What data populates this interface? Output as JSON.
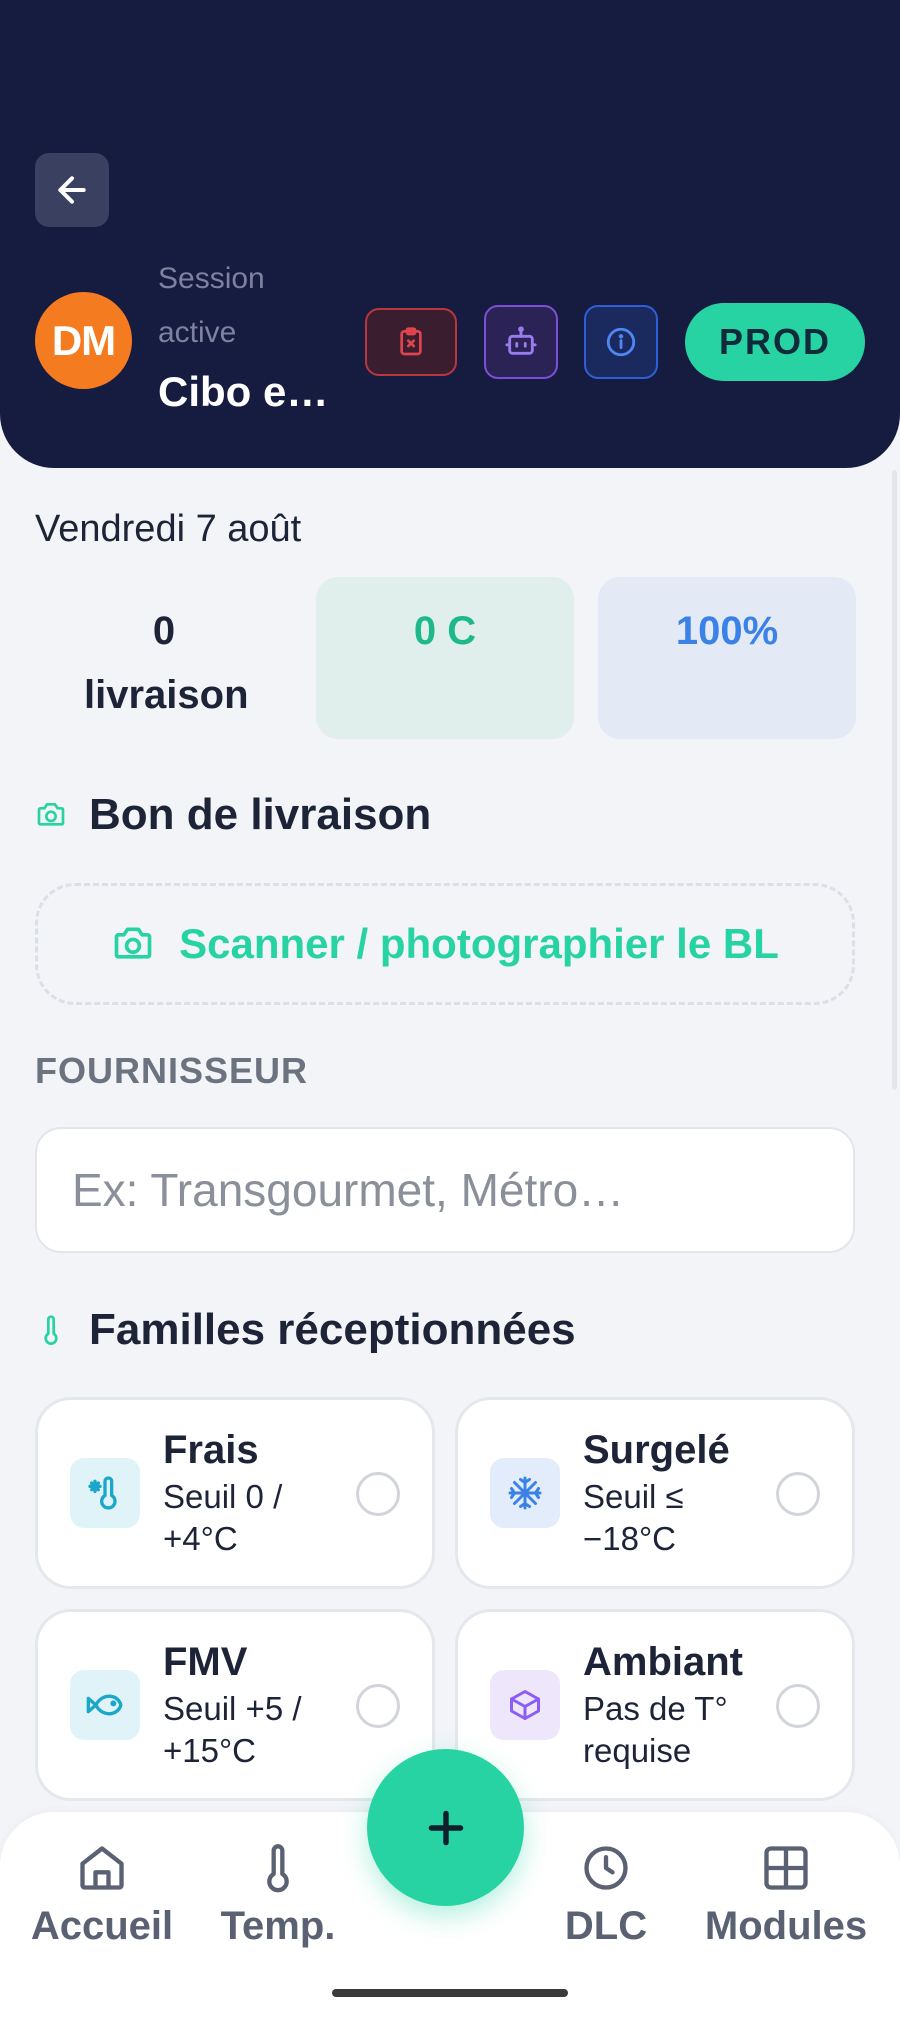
{
  "header": {
    "session_label": "Session active",
    "avatar_initials": "DM",
    "session_name": "Cibo e…",
    "env_badge": "PROD"
  },
  "main": {
    "date": "Vendredi 7 août",
    "stats": [
      {
        "value": "0 livraison"
      },
      {
        "value": "0 C"
      },
      {
        "value": "100%"
      }
    ],
    "delivery_note": {
      "title": "Bon de livraison",
      "scan_label": "Scanner / photographier le BL"
    },
    "supplier": {
      "label": "FOURNISSEUR",
      "placeholder": "Ex: Transgourmet, Métro…",
      "value": ""
    },
    "families": {
      "title": "Familles réceptionnées",
      "items": [
        {
          "name": "Frais",
          "desc": "Seuil 0 / +4°C",
          "icon": "thermometer-snow-icon",
          "color": "#1ba7c9"
        },
        {
          "name": "Surgelé",
          "desc": "Seuil ≤ −18°C",
          "icon": "snowflake-icon",
          "color": "#3b82e6"
        },
        {
          "name": "FMV",
          "desc": "Seuil +5 / +15°C",
          "icon": "fish-icon",
          "color": "#1ba7c9"
        },
        {
          "name": "Ambiant",
          "desc": "Pas de T° requise",
          "icon": "package-icon",
          "color": "#8b5cf6"
        }
      ]
    }
  },
  "nav": {
    "items": [
      {
        "label": "Accueil",
        "icon": "home-icon"
      },
      {
        "label": "Temp.",
        "icon": "thermometer-icon"
      },
      {
        "label": "DLC",
        "icon": "clock-icon"
      },
      {
        "label": "Modules",
        "icon": "grid-icon"
      }
    ],
    "fab_icon": "plus-icon"
  },
  "colors": {
    "header_bg": "#161c3f",
    "accent": "#27d3a3",
    "avatar": "#f47b20",
    "danger": "#b8363e",
    "purple": "#7c4fd8",
    "blue": "#3b82e6"
  }
}
